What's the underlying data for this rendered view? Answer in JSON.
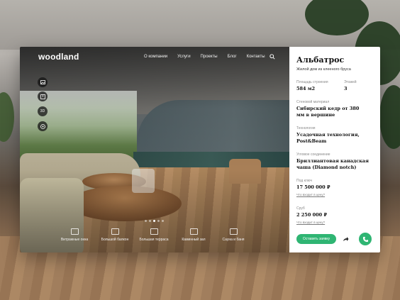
{
  "header": {
    "logo": "woodland",
    "nav": [
      "О компании",
      "Услуги",
      "Проекты",
      "Блог",
      "Контакты"
    ]
  },
  "side_buttons": [
    {
      "icon": "gallery-icon",
      "label": ""
    },
    {
      "icon": "plan-icon",
      "label": ""
    },
    {
      "icon": "3d-icon",
      "label": "3D"
    },
    {
      "icon": "tour-icon",
      "label": ""
    }
  ],
  "features": [
    "Витражные окна",
    "Большой балкон",
    "Большая терраса",
    "Каминный зал",
    "Сауна и баня"
  ],
  "slider": {
    "count": 5,
    "active": 2
  },
  "panel": {
    "title": "Альбатрос",
    "subtitle": "Жилой дом из клееного бруса",
    "area_label": "Площадь строения",
    "area_value": "584 м2",
    "floors_label": "Этажей",
    "floors_value": "3",
    "material_label": "Стеновой материал",
    "material_value": "Сибирский кедр от 380 мм в вершине",
    "tech_label": "Технология",
    "tech_value": "Усадочная технология, Post&Beam",
    "corner_label": "Угловое соединение",
    "corner_value": "Бриллиантовая канадская чаша (Diamond notch)",
    "price_key_label": "Под ключ",
    "price_key_value": "17 500 000 ₽",
    "price_key_link": "Что входит в цену?",
    "price_shell_label": "Сруб",
    "price_shell_value": "2 250 000 ₽",
    "price_shell_link": "Что входит в цену?",
    "cta": "Оставить заявку"
  },
  "colors": {
    "accent": "#2fb573"
  }
}
